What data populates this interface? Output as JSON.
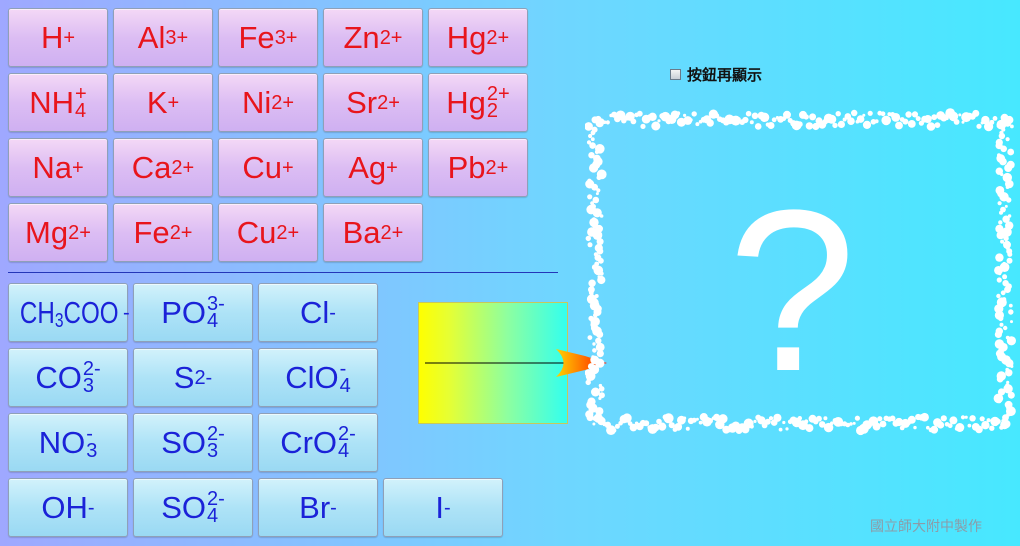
{
  "cations": [
    {
      "base": "H",
      "sup": "+"
    },
    {
      "base": "Al",
      "sup": "3+"
    },
    {
      "base": "Fe",
      "sup": "3+"
    },
    {
      "base": "Zn",
      "sup": "2+"
    },
    {
      "base": "Hg",
      "sup": "2+"
    },
    {
      "base": "NH",
      "sub": "4",
      "sup": "+"
    },
    {
      "base": "K",
      "sup": "+"
    },
    {
      "base": "Ni",
      "sup": "2+"
    },
    {
      "base": "Sr",
      "sup": "2+"
    },
    {
      "base": "Hg",
      "sub": "2",
      "sup": "2+"
    },
    {
      "base": "Na",
      "sup": "+"
    },
    {
      "base": "Ca",
      "sup": "2+"
    },
    {
      "base": "Cu",
      "sup": "+"
    },
    {
      "base": "Ag",
      "sup": "+"
    },
    {
      "base": "Pb",
      "sup": "2+"
    },
    {
      "base": "Mg",
      "sup": "2+"
    },
    {
      "base": "Fe",
      "sup": "2+"
    },
    {
      "base": "Cu",
      "sup": "2+"
    },
    {
      "base": "Ba",
      "sup": "2+"
    }
  ],
  "anions": [
    {
      "base": "CH3COO",
      "sup": "-",
      "condensed": true
    },
    {
      "base": "PO",
      "sub": "4",
      "sup": "3-"
    },
    {
      "base": "Cl",
      "sup": "-"
    },
    {
      "base": "CO",
      "sub": "3",
      "sup": "2-"
    },
    {
      "base": "S",
      "sup": "2-"
    },
    {
      "base": "ClO",
      "sub": "4",
      "sup": "-"
    },
    {
      "base": "NO",
      "sub": "3",
      "sup": "-"
    },
    {
      "base": "SO",
      "sub": "3",
      "sup": "2-"
    },
    {
      "base": "CrO",
      "sub": "4",
      "sup": "2-"
    },
    {
      "base": "OH",
      "sup": "-"
    },
    {
      "base": "SO",
      "sub": "4",
      "sup": "2-"
    },
    {
      "base": "Br",
      "sup": "-"
    },
    {
      "base": "I",
      "sup": "-"
    }
  ],
  "checkbox": {
    "label": "按鈕再顯示",
    "checked": false
  },
  "result": {
    "placeholder": "?"
  },
  "footer": {
    "credit": "國立師大附中製作"
  },
  "colors": {
    "cation_text": "#e8151c",
    "anion_text": "#1b22d8"
  }
}
